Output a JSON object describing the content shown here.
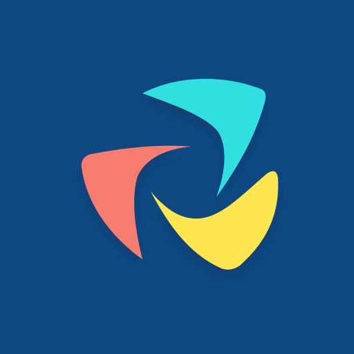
{
  "app_icon": {
    "symbol": "swirl-logo-icon",
    "colors": {
      "background": "#0f4a84",
      "cyan_blade": "#33dfe0",
      "coral_blade": "#f87d71",
      "yellow_blade": "#fde64f",
      "shadow": "#082f58"
    }
  }
}
